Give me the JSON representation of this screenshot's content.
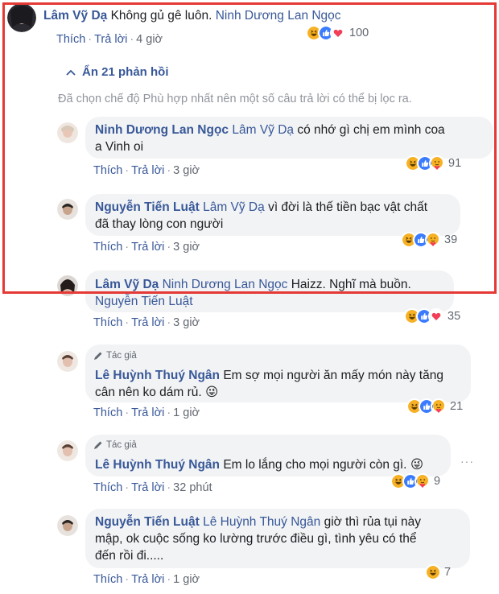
{
  "actions": {
    "like": "Thích",
    "reply": "Trả lời"
  },
  "top_comment": {
    "author": "Lâm Vỹ Dạ",
    "text": "Không gủ gê luôn.",
    "mention": "Ninh Dương Lan Ngọc",
    "time": "4 giờ",
    "reactions": [
      "haha",
      "like",
      "love"
    ],
    "reaction_count": "100"
  },
  "hide_replies": "Ẩn 21 phản hồi",
  "filter_notice": "Đã chọn chế độ Phù hợp nhất nên một số câu trả lời có thể bị lọc ra.",
  "replies": [
    {
      "author": "Ninh Dương Lan Ngọc",
      "mention": "Lâm Vỹ Dạ",
      "text_line1": "có nhớ gì chị em mình coa",
      "text_line2": "a Vinh oi",
      "time": "3 giờ",
      "reactions": [
        "haha",
        "like",
        "care"
      ],
      "reaction_count": "91"
    },
    {
      "author": "Nguyễn Tiến Luật",
      "mention": "Lâm Vỹ Dạ",
      "text_line1": "vì đời là thế tiền bạc vật chất",
      "text_line2": "đã thay lòng con người",
      "time": "3 giờ",
      "reactions": [
        "haha",
        "like",
        "care"
      ],
      "reaction_count": "39"
    },
    {
      "author": "Lâm Vỹ Dạ",
      "mention": "Ninh Dương Lan Ngọc",
      "text_line1": "Haizz. Nghĩ mà buồn.",
      "text_line2": "Nguyễn Tiến Luật",
      "time": "3 giờ",
      "reactions": [
        "haha",
        "like",
        "love"
      ],
      "reaction_count": "35"
    },
    {
      "badge": "Tác giả",
      "author": "Lê Huỳnh Thuý Ngân",
      "text_line1": "Em sợ mọi người ăn mấy món này tăng",
      "text_line2": "cân nên ko dám rủ.",
      "emoji": "😜",
      "time": "1 giờ",
      "reactions": [
        "haha",
        "like",
        "care"
      ],
      "reaction_count": "21"
    },
    {
      "badge": "Tác giả",
      "author": "Lê Huỳnh Thuý Ngân",
      "text_line1": "Em lo lắng cho mọi người còn gì.",
      "emoji": "😜",
      "more": "···",
      "time": "32 phút",
      "reactions": [
        "haha",
        "like",
        "care"
      ],
      "reaction_count": "9"
    },
    {
      "author": "Nguyễn Tiến Luật",
      "mention": "Lê Huỳnh Thuý Ngân",
      "text_line1": "giờ thì rủa tụi này",
      "text_line2": "mập, ok cuộc sống ko lường trước điều gì, tình yêu có thể",
      "text_line3": "đến rồi đi.....",
      "time": "1 giờ",
      "reactions": [
        "haha"
      ],
      "reaction_count": "7"
    }
  ],
  "colors": {
    "frame": "#e53935",
    "link": "#385898",
    "bubble": "#f2f3f5",
    "muted": "#616770"
  }
}
